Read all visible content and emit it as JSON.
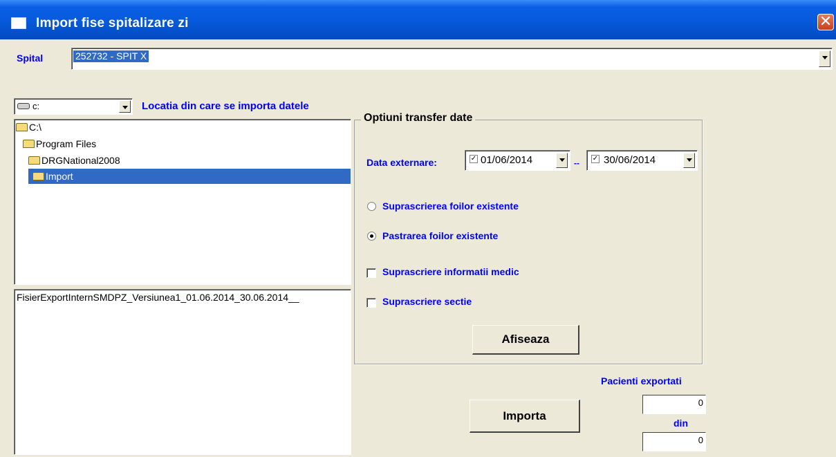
{
  "window": {
    "title": "Import fise spitalizare zi",
    "close_glyph": "✕"
  },
  "spital": {
    "label": "Spital",
    "value": "252732 - SPIT X"
  },
  "drive": {
    "value": "c:",
    "location_label": "Locatia din care se importa datele"
  },
  "folders": [
    {
      "name": "C:\\",
      "selected": false
    },
    {
      "name": "Program Files",
      "selected": false
    },
    {
      "name": "DRGNational2008",
      "selected": false
    },
    {
      "name": "Import",
      "selected": true
    }
  ],
  "files": [
    "FisierExportInternSMDPZ_Versiunea1_01.06.2014_30.06.2014__"
  ],
  "options": {
    "title": "Optiuni transfer date",
    "date_label": "Data externare:",
    "date_from": "01/06/2014",
    "date_sep": "--",
    "date_to": "30/06/2014",
    "date_from_checked": true,
    "date_to_checked": true,
    "radio_overwrite": "Suprascrierea foilor existente",
    "radio_keep": "Pastrarea foilor existente",
    "selected_radio": "keep",
    "check_medic": "Suprascriere informatii medic",
    "check_medic_checked": false,
    "check_sectie": "Suprascriere sectie",
    "check_sectie_checked": false,
    "afiseaza": "Afiseaza"
  },
  "import": {
    "button": "Importa",
    "exported_label": "Pacienti exportati",
    "exported_value": "0",
    "din_label": "din",
    "total_value": "0"
  },
  "colors": {
    "titlebar": "#0558d8",
    "label_blue": "#0000ff",
    "selection": "#316ac5",
    "window_bg": "#ece9d8"
  }
}
